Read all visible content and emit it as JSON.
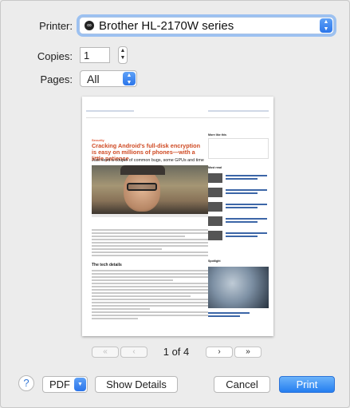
{
  "printer": {
    "label": "Printer:",
    "value": "Brother HL-2170W series"
  },
  "copies": {
    "label": "Copies:",
    "value": "1"
  },
  "pages": {
    "label": "Pages:",
    "value": "All"
  },
  "preview": {
    "tag": "Security",
    "title": "Cracking Android's full-disk encryption is easy on millions of phones—with a little patience",
    "subtitle": "Just need a couple of common bugs, some GPUs and time",
    "section_heading": "The tech details",
    "sidebar_headings": [
      "More like this",
      "Most read",
      "Spotlight"
    ]
  },
  "pager": {
    "first": "«",
    "prev": "‹",
    "next": "›",
    "last": "»",
    "status": "1 of 4"
  },
  "footer": {
    "help": "?",
    "pdf": "PDF",
    "show_details": "Show Details",
    "cancel": "Cancel",
    "print": "Print"
  },
  "icons": {
    "printer": "printer-status-icon",
    "updown": "updown-chevron-icon",
    "stepper": "stepper-arrows-icon",
    "dropdown": "chevron-down-icon"
  },
  "colors": {
    "accent": "#2b75ea",
    "article_title": "#cf4a23"
  }
}
